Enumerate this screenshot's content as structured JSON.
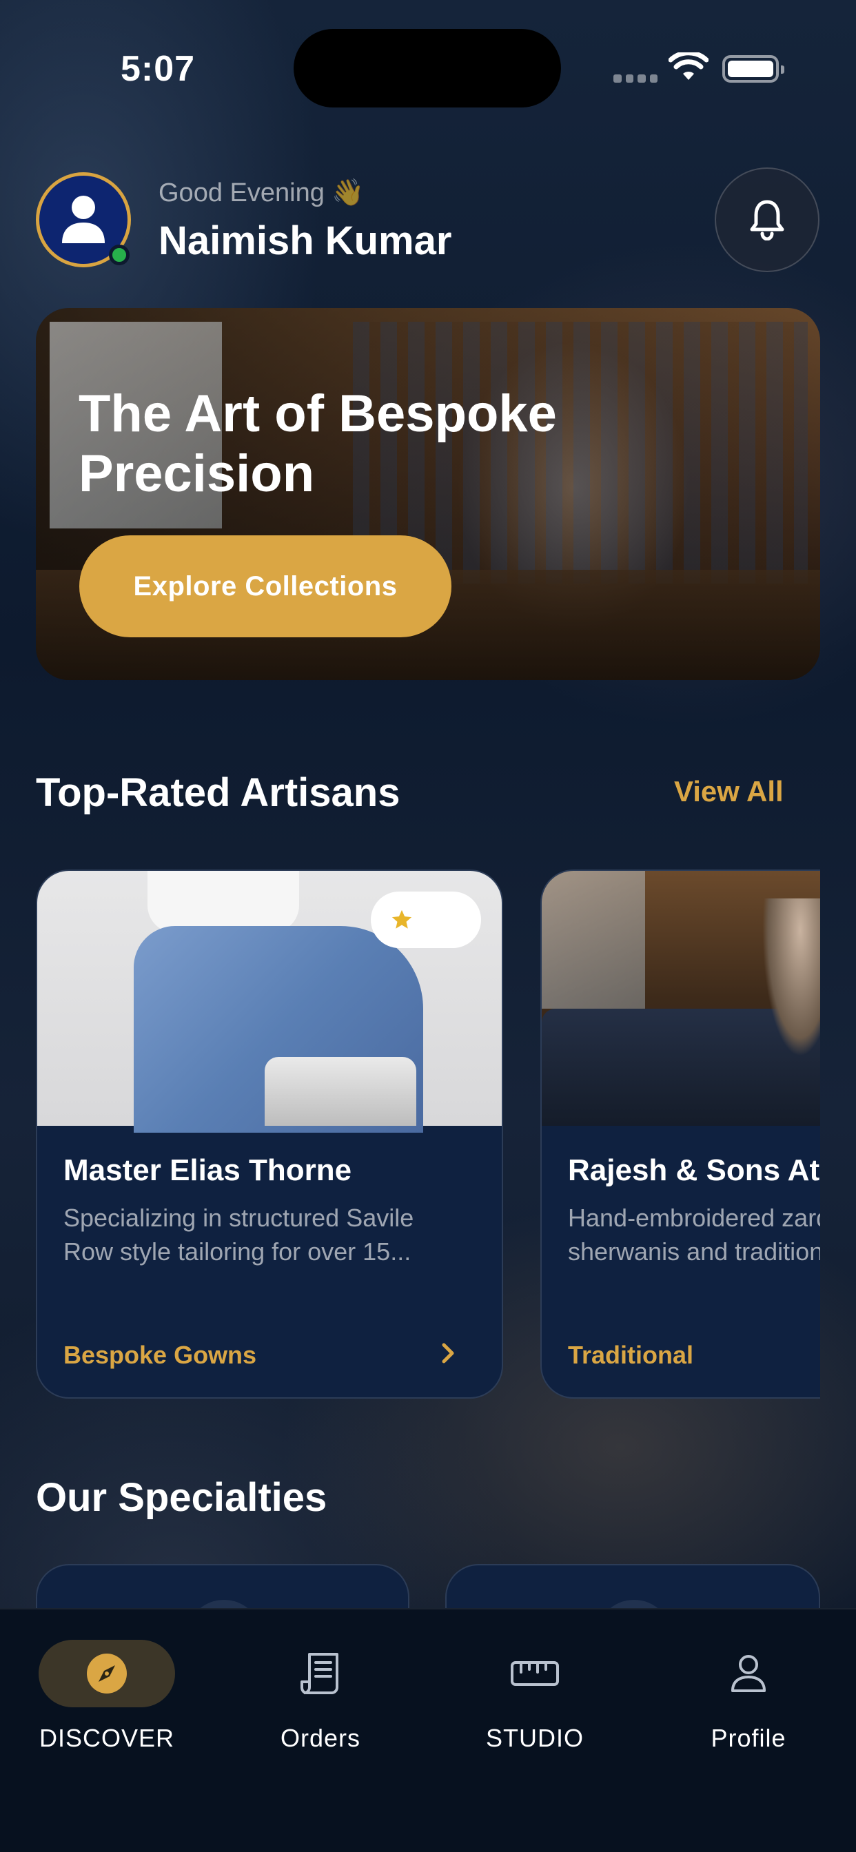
{
  "status_bar": {
    "time": "5:07"
  },
  "header": {
    "greeting": "Good Evening 👋",
    "user_name": "Naimish Kumar"
  },
  "hero": {
    "title": "The Art of Bespoke Precision",
    "button_label": "Explore Collections"
  },
  "artisans_section": {
    "title": "Top-Rated Artisans",
    "view_all_label": "View All",
    "cards": [
      {
        "name": "Master Elias Thorne",
        "description_line1": "Specializing in structured Savile",
        "description_line2": "Row style tailoring for over 15...",
        "tag": "Bespoke Gowns"
      },
      {
        "name": "Rajesh & Sons Atelier",
        "description_line1": "Hand-embroidered zardozi",
        "description_line2": "sherwanis and traditional",
        "tag": "Traditional"
      }
    ]
  },
  "specialties_section": {
    "title": "Our Specialties"
  },
  "tabbar": {
    "tabs": [
      {
        "label": "DISCOVER",
        "icon": "compass-icon",
        "active": true
      },
      {
        "label": "Orders",
        "icon": "receipt-icon",
        "active": false
      },
      {
        "label": "STUDIO",
        "icon": "ruler-icon",
        "active": false
      },
      {
        "label": "Profile",
        "icon": "person-icon",
        "active": false
      }
    ]
  },
  "colors": {
    "accent": "#daa644",
    "background": "#0d1a2e",
    "card": "#0f2140",
    "online": "#27b14b"
  }
}
